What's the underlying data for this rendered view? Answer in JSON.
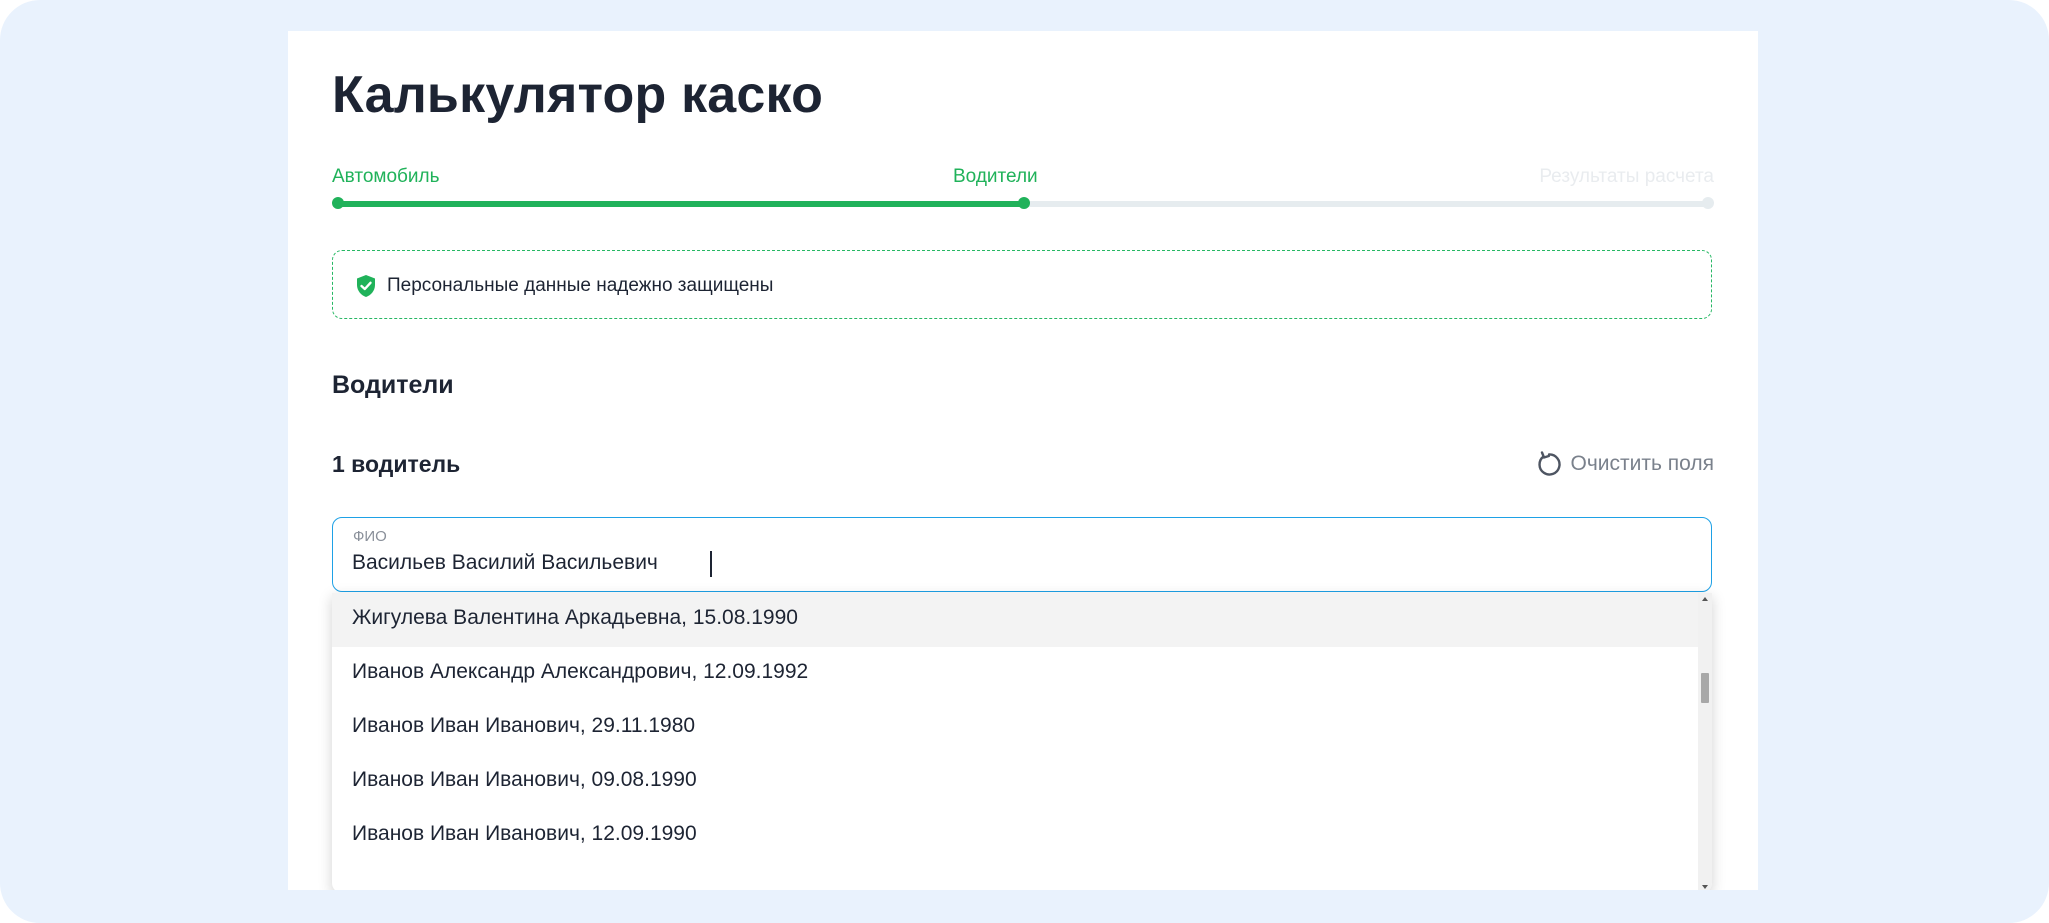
{
  "page": {
    "title": "Калькулятор каско"
  },
  "steps": [
    {
      "label": "Автомобиль",
      "state": "done"
    },
    {
      "label": "Водители",
      "state": "current"
    },
    {
      "label": "Результаты расчета",
      "state": "todo"
    }
  ],
  "progress": {
    "completed_fraction": 0.5
  },
  "notice": {
    "icon": "shield-check-icon",
    "text": "Персональные данные надежно защищены"
  },
  "section": {
    "title": "Водители"
  },
  "driver": {
    "title": "1 водитель",
    "clear_label": "Очистить поля",
    "clear_icon": "reset-icon",
    "fio_label": "ФИО",
    "fio_value": "Васильев Василий Васильевич"
  },
  "suggestions": [
    "Жигулева Валентина Аркадьевна, 15.08.1990",
    "Иванов Александр Александрович, 12.09.1992",
    "Иванов Иван Иванович, 29.11.1980",
    "Иванов Иван Иванович, 09.08.1990",
    "Иванов Иван Иванович, 12.09.1990"
  ],
  "colors": {
    "accent_green": "#20b25a",
    "focus_blue": "#1ea1e6",
    "text_dark": "#1d2433",
    "background": "#e9f2fd"
  }
}
